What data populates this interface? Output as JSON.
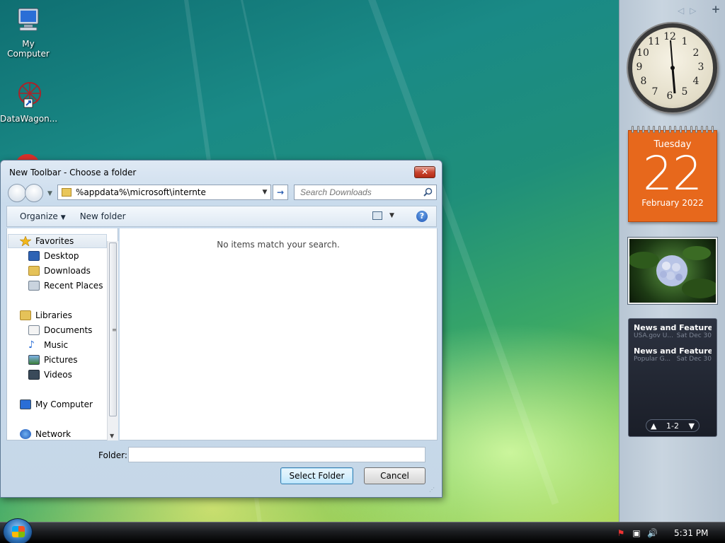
{
  "desktop": {
    "icons": [
      {
        "label": "My Computer",
        "icon": "computer-icon"
      },
      {
        "label": "DataWagon...",
        "icon": "datawagon-shortcut-icon"
      }
    ]
  },
  "dialog": {
    "title": "New Toolbar - Choose a folder",
    "close_label": "✕",
    "address_value": "%appdata%\\microsoft\\internte",
    "search_placeholder": "Search Downloads",
    "toolbar": {
      "organize": "Organize",
      "new_folder": "New folder",
      "help": "?"
    },
    "nav": {
      "favorites": "Favorites",
      "desktop": "Desktop",
      "downloads": "Downloads",
      "recent_places": "Recent Places",
      "libraries": "Libraries",
      "documents": "Documents",
      "music": "Music",
      "pictures": "Pictures",
      "videos": "Videos",
      "my_computer": "My Computer",
      "network": "Network"
    },
    "empty_message": "No items match your search.",
    "folder_label": "Folder:",
    "folder_value": "",
    "select_button": "Select Folder",
    "cancel_button": "Cancel"
  },
  "sidebar": {
    "calendar": {
      "weekday": "Tuesday",
      "day": "22",
      "month_year": "February 2022"
    },
    "feeds": {
      "items": [
        {
          "title": "News and Features f...",
          "source": "USA.gov U...",
          "date": "Sat Dec 30"
        },
        {
          "title": "News and Features f...",
          "source": "Popular G...",
          "date": "Sat Dec 30"
        }
      ],
      "pager": "1-2"
    }
  },
  "taskbar": {
    "time": "5:31 PM"
  },
  "colors": {
    "calendar_orange": "#e7681c",
    "dialog_frame": "#c6d7e8",
    "taskbar": "#1b1d20"
  }
}
